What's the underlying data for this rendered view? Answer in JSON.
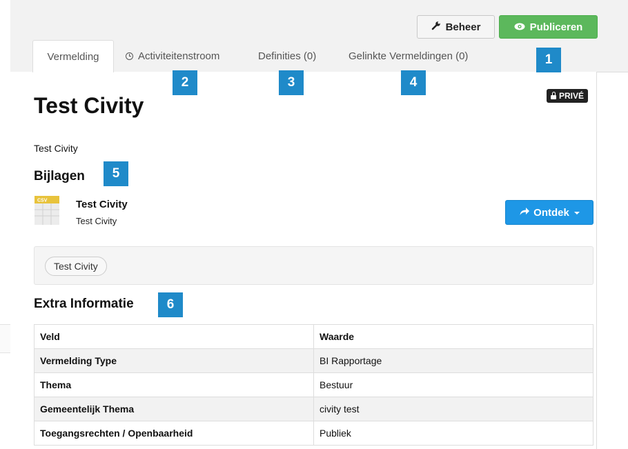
{
  "header": {
    "manage_label": "Beheer",
    "publish_label": "Publiceren"
  },
  "tabs": [
    {
      "label": "Vermelding"
    },
    {
      "label": "Activiteitenstroom"
    },
    {
      "label": "Definities (0)"
    },
    {
      "label": "Gelinkte Vermeldingen (0)"
    }
  ],
  "callouts": [
    "1",
    "2",
    "3",
    "4",
    "5",
    "6"
  ],
  "dataset": {
    "title": "Test Civity",
    "private_badge": "PRIVÉ",
    "description": "Test Civity"
  },
  "attachments": {
    "heading": "Bijlagen",
    "items": [
      {
        "name": "Test Civity",
        "description": "Test Civity",
        "format_icon": "csv-file-icon",
        "format_label": "CSV"
      }
    ],
    "explore_label": "Ontdek"
  },
  "tags": [
    "Test Civity"
  ],
  "extra_info": {
    "heading": "Extra Informatie",
    "columns": [
      "Veld",
      "Waarde"
    ],
    "rows": [
      {
        "field": "Vermelding Type",
        "value": "BI Rapportage"
      },
      {
        "field": "Thema",
        "value": "Bestuur"
      },
      {
        "field": "Gemeentelijk Thema",
        "value": "civity test"
      },
      {
        "field": "Toegangsrechten / Openbaarheid",
        "value": "Publiek"
      }
    ]
  },
  "colors": {
    "publish_green": "#5cb85c",
    "explore_blue": "#1e97e6",
    "callout_blue": "#1f8ac9",
    "private_badge_bg": "#222222"
  }
}
